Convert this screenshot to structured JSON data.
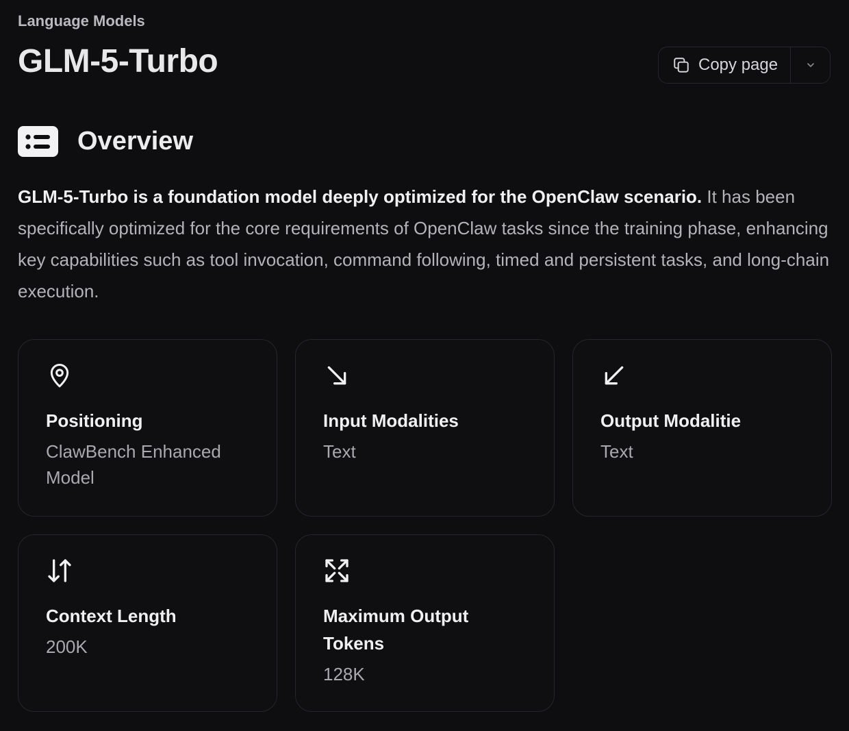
{
  "breadcrumb": "Language Models",
  "title": "GLM-5-Turbo",
  "copy_page": {
    "label": "Copy page",
    "copy_icon": "copy-icon",
    "dropdown_icon": "chevron-down-icon"
  },
  "overview": {
    "title": "Overview",
    "icon": "list-icon",
    "intro_bold": "GLM-5-Turbo is a foundation model deeply optimized for the OpenClaw scenario.",
    "intro_rest": " It has been specifically optimized for the core requirements of OpenClaw tasks since the training phase, enhancing key capabilities such as tool invocation, command following, timed and persistent tasks, and long-chain execution."
  },
  "cards": [
    {
      "icon": "map-pin-icon",
      "label": "Positioning",
      "value": "ClawBench Enhanced Model"
    },
    {
      "icon": "arrow-down-right-icon",
      "label": "Input Modalities",
      "value": "Text"
    },
    {
      "icon": "arrow-down-left-icon",
      "label": "Output Modalitie",
      "value": "Text"
    },
    {
      "icon": "arrows-up-down-icon",
      "label": "Context Length",
      "value": "200K"
    },
    {
      "icon": "expand-icon",
      "label": "Maximum Output Tokens",
      "value": "128K"
    }
  ],
  "colors": {
    "background": "#0e0e10",
    "card_border": "#26262b",
    "text_primary": "#f0f0f2",
    "text_secondary": "#a9a9ae"
  }
}
